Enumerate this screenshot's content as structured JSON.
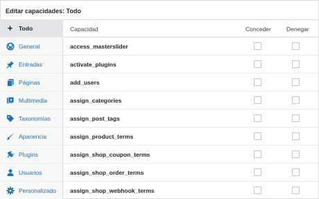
{
  "title": "Editar capacidades: Todo",
  "sidebar": {
    "items": [
      {
        "label": "Todo",
        "icon": "plus-icon",
        "name": "sidebar-item-todo"
      },
      {
        "label": "General",
        "icon": "wordpress-icon",
        "name": "sidebar-item-general"
      },
      {
        "label": "Entradas",
        "icon": "pushpin-icon",
        "name": "sidebar-item-entradas"
      },
      {
        "label": "Páginas",
        "icon": "pages-icon",
        "name": "sidebar-item-paginas"
      },
      {
        "label": "Multimedia",
        "icon": "media-icon",
        "name": "sidebar-item-multimedia"
      },
      {
        "label": "Taxonomías",
        "icon": "tag-icon",
        "name": "sidebar-item-taxonomias"
      },
      {
        "label": "Apariencia",
        "icon": "brush-icon",
        "name": "sidebar-item-apariencia"
      },
      {
        "label": "Plugins",
        "icon": "plug-icon",
        "name": "sidebar-item-plugins"
      },
      {
        "label": "Usuarios",
        "icon": "user-icon",
        "name": "sidebar-item-usuarios"
      },
      {
        "label": "Personalizado",
        "icon": "gear-icon",
        "name": "sidebar-item-personalizado"
      }
    ]
  },
  "table": {
    "headers": {
      "capability": "Capacidad",
      "grant": "Conceder",
      "deny": "Denegar"
    },
    "rows": [
      {
        "cap": "access_masterslider",
        "grant": false,
        "deny": false
      },
      {
        "cap": "activate_plugins",
        "grant": false,
        "deny": false
      },
      {
        "cap": "add_users",
        "grant": false,
        "deny": false
      },
      {
        "cap": "assign_categories",
        "grant": false,
        "deny": false
      },
      {
        "cap": "assign_post_tags",
        "grant": false,
        "deny": false
      },
      {
        "cap": "assign_product_terms",
        "grant": false,
        "deny": false
      },
      {
        "cap": "assign_shop_coupon_terms",
        "grant": false,
        "deny": false
      },
      {
        "cap": "assign_shop_order_terms",
        "grant": false,
        "deny": false
      },
      {
        "cap": "assign_shop_webhook_terms",
        "grant": false,
        "deny": false
      }
    ]
  },
  "colors": {
    "link": "#2271b1",
    "icon": "#2271b1",
    "border": "#dcdcde"
  }
}
